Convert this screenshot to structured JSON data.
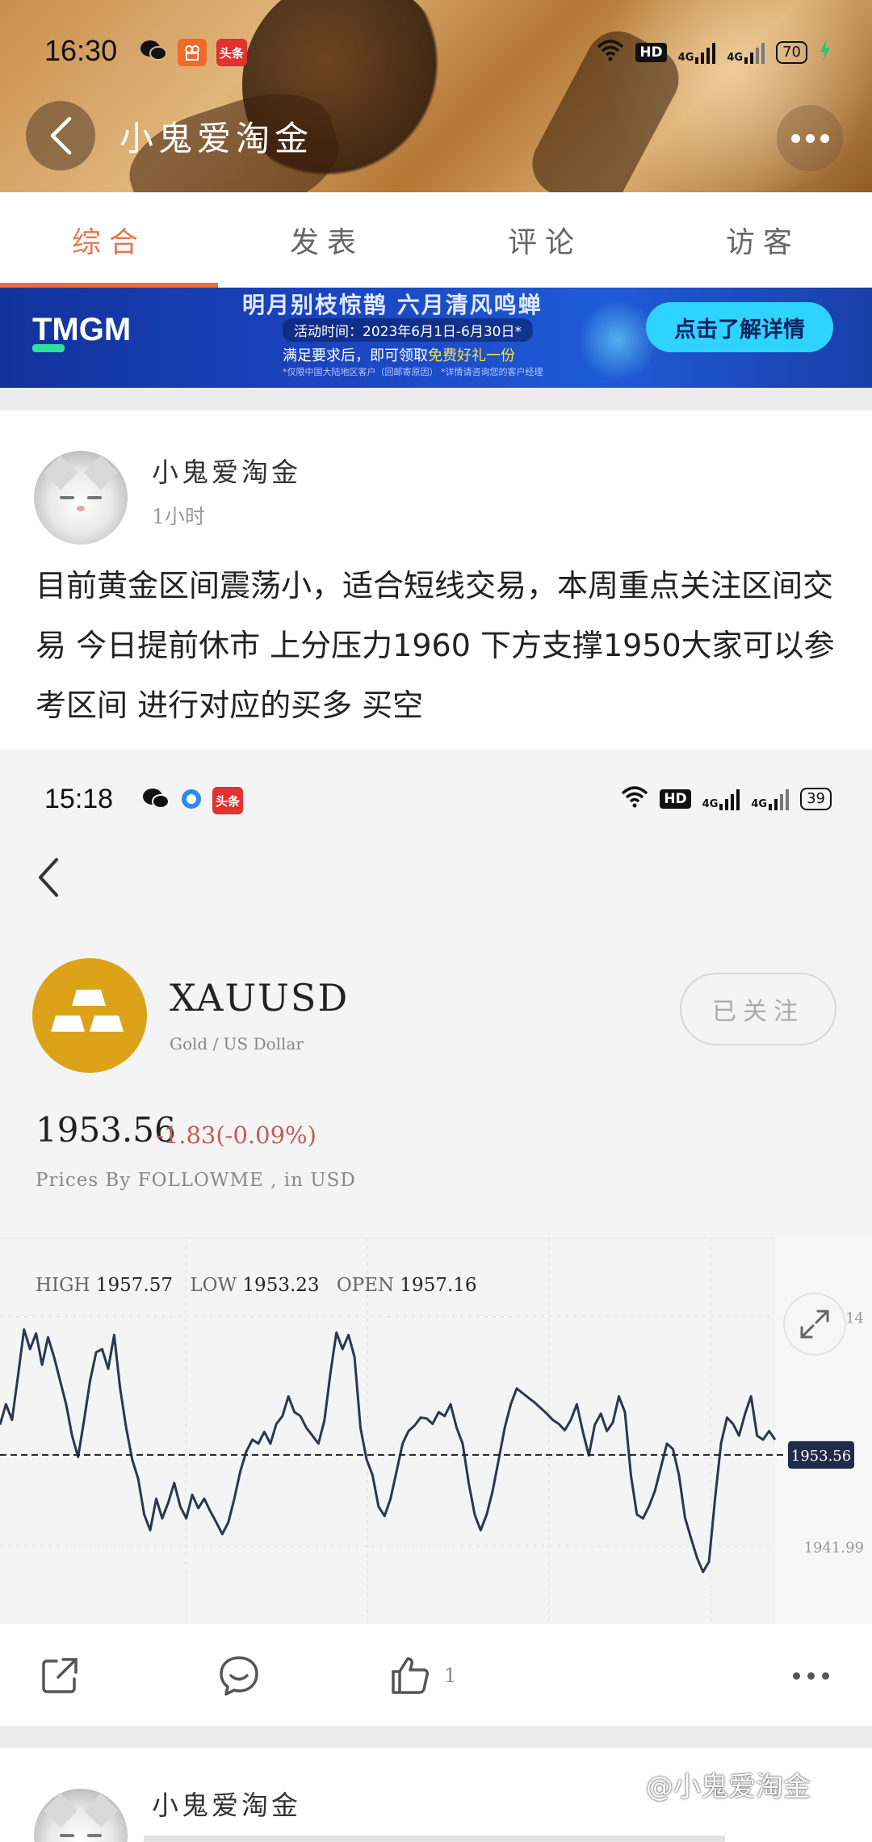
{
  "status_bar": {
    "time": "16:30",
    "hd_label": "HD",
    "network_1": "4G",
    "network_2": "4G",
    "battery": "70",
    "app_icons": [
      "wechat-icon",
      "kuaishou-icon",
      "toutiao-icon"
    ],
    "toutiao_label": "头条"
  },
  "header": {
    "title": "小鬼爱淘金"
  },
  "tabs": [
    {
      "label": "综合",
      "active": true
    },
    {
      "label": "发表",
      "active": false
    },
    {
      "label": "评论",
      "active": false
    },
    {
      "label": "访客",
      "active": false
    }
  ],
  "banner": {
    "brand": "TMGM",
    "title": "明月别枝惊鹊 六月清风鸣蝉",
    "date_line": "活动时间：2023年6月1日-6月30日*",
    "offer_prefix": "满足要求后，即可领取",
    "offer_highlight": "免费好礼一份",
    "fine_print": "*仅限中国大陆地区客户（回邮寄原因）  *详情请咨询您的客户经理",
    "cta": "点击了解详情"
  },
  "post": {
    "author": "小鬼爱淘金",
    "time": "1小时",
    "text": "目前黄金区间震荡小，适合短线交易，本周重点关注区间交易 今日提前休市 上分压力1960 下方支撑1950大家可以参考区间 进行对应的买多 买空"
  },
  "embedded": {
    "status_time": "15:18",
    "hd_label": "HD",
    "network_1": "4G",
    "network_2": "4G",
    "battery": "39",
    "toutiao_label": "头条",
    "symbol": "XAUUSD",
    "symbol_desc": "Gold / US Dollar",
    "follow_label": "已关注",
    "price": "1953.56",
    "change": "-1.83(-0.09%)",
    "prices_by": "Prices By FOLLOWME , in USD",
    "high_label": "HIGH",
    "high": "1957.57",
    "low_label": "LOW",
    "low": "1953.23",
    "open_label": "OPEN",
    "open": "1957.16"
  },
  "chart_data": {
    "type": "line",
    "ylim": [
      1936,
      1975
    ],
    "y_ticks": [
      "1971.14",
      "1941.99"
    ],
    "current_price_label": "1953.56",
    "current_price": 1953.56,
    "color": "#2b3750",
    "values": [
      1957.4,
      1960,
      1958,
      1963.6,
      1969.5,
      1967,
      1969,
      1965,
      1968.5,
      1966,
      1963,
      1960,
      1956,
      1953.3,
      1958,
      1963,
      1966.6,
      1967,
      1964.5,
      1968.8,
      1962,
      1957,
      1953,
      1950.5,
      1946,
      1944,
      1948,
      1945.5,
      1947.5,
      1950,
      1947,
      1945.5,
      1948.5,
      1946.8,
      1948,
      1946.4,
      1945,
      1943.5,
      1945,
      1948,
      1951.5,
      1954,
      1955.5,
      1955,
      1956.5,
      1955,
      1957.5,
      1958.5,
      1961,
      1959,
      1958.5,
      1957,
      1956,
      1955,
      1958,
      1964,
      1969.1,
      1967,
      1968.8,
      1966,
      1957,
      1953,
      1951,
      1947,
      1945.8,
      1948,
      1951.5,
      1955,
      1956.6,
      1957.3,
      1958.3,
      1958.2,
      1957.5,
      1959,
      1958.5,
      1960,
      1957,
      1955,
      1950,
      1946,
      1944,
      1946,
      1949,
      1953,
      1957,
      1960,
      1962,
      1961.4,
      1960.8,
      1960.2,
      1959.5,
      1958.8,
      1958,
      1957.5,
      1956.7,
      1958,
      1960,
      1956.5,
      1953.5,
      1957.4,
      1958.8,
      1956.6,
      1957.7,
      1961,
      1959,
      1951,
      1946,
      1945.5,
      1947,
      1949,
      1952,
      1955,
      1954.3,
      1951,
      1945.6,
      1943,
      1940.5,
      1938.7,
      1940,
      1948,
      1955,
      1958.3,
      1957.5,
      1956,
      1958.8,
      1961,
      1956,
      1955.5,
      1956.6,
      1955.5
    ],
    "grid": true,
    "legend": "none"
  },
  "actions": {
    "like_count": "1"
  },
  "post2": {
    "author": "小鬼爱淘金"
  },
  "watermark": "@小鬼爱淘金"
}
